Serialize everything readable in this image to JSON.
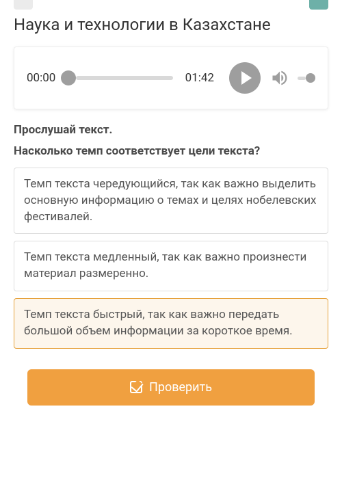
{
  "title": "Наука и технологии в Казахстане",
  "audio": {
    "current": "00:00",
    "duration": "01:42"
  },
  "instruction": "Прослушай текст.",
  "question": "Насколько темп соответствует цели текста?",
  "options": [
    {
      "text": "Темп текста чередующийся, так как важно выделить основную информацию о темах и целях нобелевских фестивалей.",
      "selected": false
    },
    {
      "text": "Темп текста медленный, так как важно произнести материал размеренно.",
      "selected": false
    },
    {
      "text": "Темп текста быстрый, так как важно передать большой объем информации за короткое время.",
      "selected": true
    }
  ],
  "check_label": "Проверить"
}
